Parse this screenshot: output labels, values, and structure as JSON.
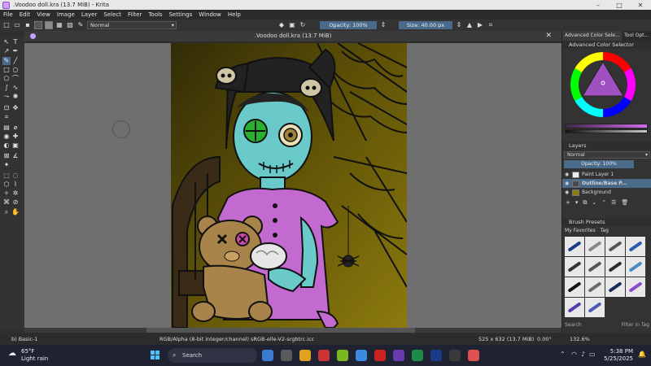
{
  "window": {
    "title": ".Voodoo doll.kra (13.7 MiB) - Krita",
    "controls": [
      "–",
      "□",
      "✕"
    ]
  },
  "menu": [
    "File",
    "Edit",
    "View",
    "Image",
    "Layer",
    "Select",
    "Filter",
    "Tools",
    "Settings",
    "Window",
    "Help"
  ],
  "toolbar": {
    "blend_mode": "Normal",
    "opacity": "Opacity: 100%",
    "size": "Size: 40.00 px",
    "colors": {
      "foreground": "#555555",
      "background": "#8a8a8a"
    }
  },
  "document": {
    "title": ".Voodoo doll.kra (13.7 MiB)",
    "close": "✕"
  },
  "dock": {
    "tabs": [
      "Advanced Color Sele...",
      "Tool Opt..."
    ],
    "color_selector_title": "Advanced Color Selector",
    "selected_color": "#d26af0",
    "layers": {
      "title": "Layers",
      "blend": "Normal",
      "opacity": "Opacity:  100%",
      "items": [
        {
          "name": "Paint Layer 1",
          "selected": false
        },
        {
          "name": "Outline/Base P...",
          "selected": true
        },
        {
          "name": "Background",
          "selected": false
        }
      ]
    },
    "presets": {
      "title": "Brush Presets",
      "filter": "My Favorites",
      "tag": "Tag",
      "search_placeholder": "Search",
      "filter_in_tag": "Filter in Tag",
      "brush_colors": [
        "#1a3a8a",
        "#888888",
        "#555555",
        "#2a5ab0",
        "#333333",
        "#555555",
        "#2a2a2a",
        "#4a8ac0",
        "#111111",
        "#6a6a6a",
        "#1a2a5a",
        "#8a4ad0",
        "#5a3ab0",
        "#4a5ab0"
      ]
    }
  },
  "status": {
    "brush": "b) Basic-1",
    "color_space": "RGB/Alpha (8-bit integer/channel)   sRGB-elle-V2-srgbtrc.icc",
    "image_size": "525 x 632 (13.7 MiB)",
    "rotation": "0.00°",
    "zoom": "132.6%"
  },
  "taskbar": {
    "weather_temp": "65°F",
    "weather_desc": "Light rain",
    "search": "Search",
    "time": "5:38 PM",
    "date": "5/25/2025",
    "apps": [
      "#3a7ad0",
      "#5a5a5a",
      "#e0a020",
      "#cc3333",
      "#7ab820",
      "#3a8ae0",
      "#cc2222",
      "#6a3ab0",
      "#1e8a4a",
      "#1a3a8a",
      "#3a3a3a",
      "#e05050"
    ]
  }
}
